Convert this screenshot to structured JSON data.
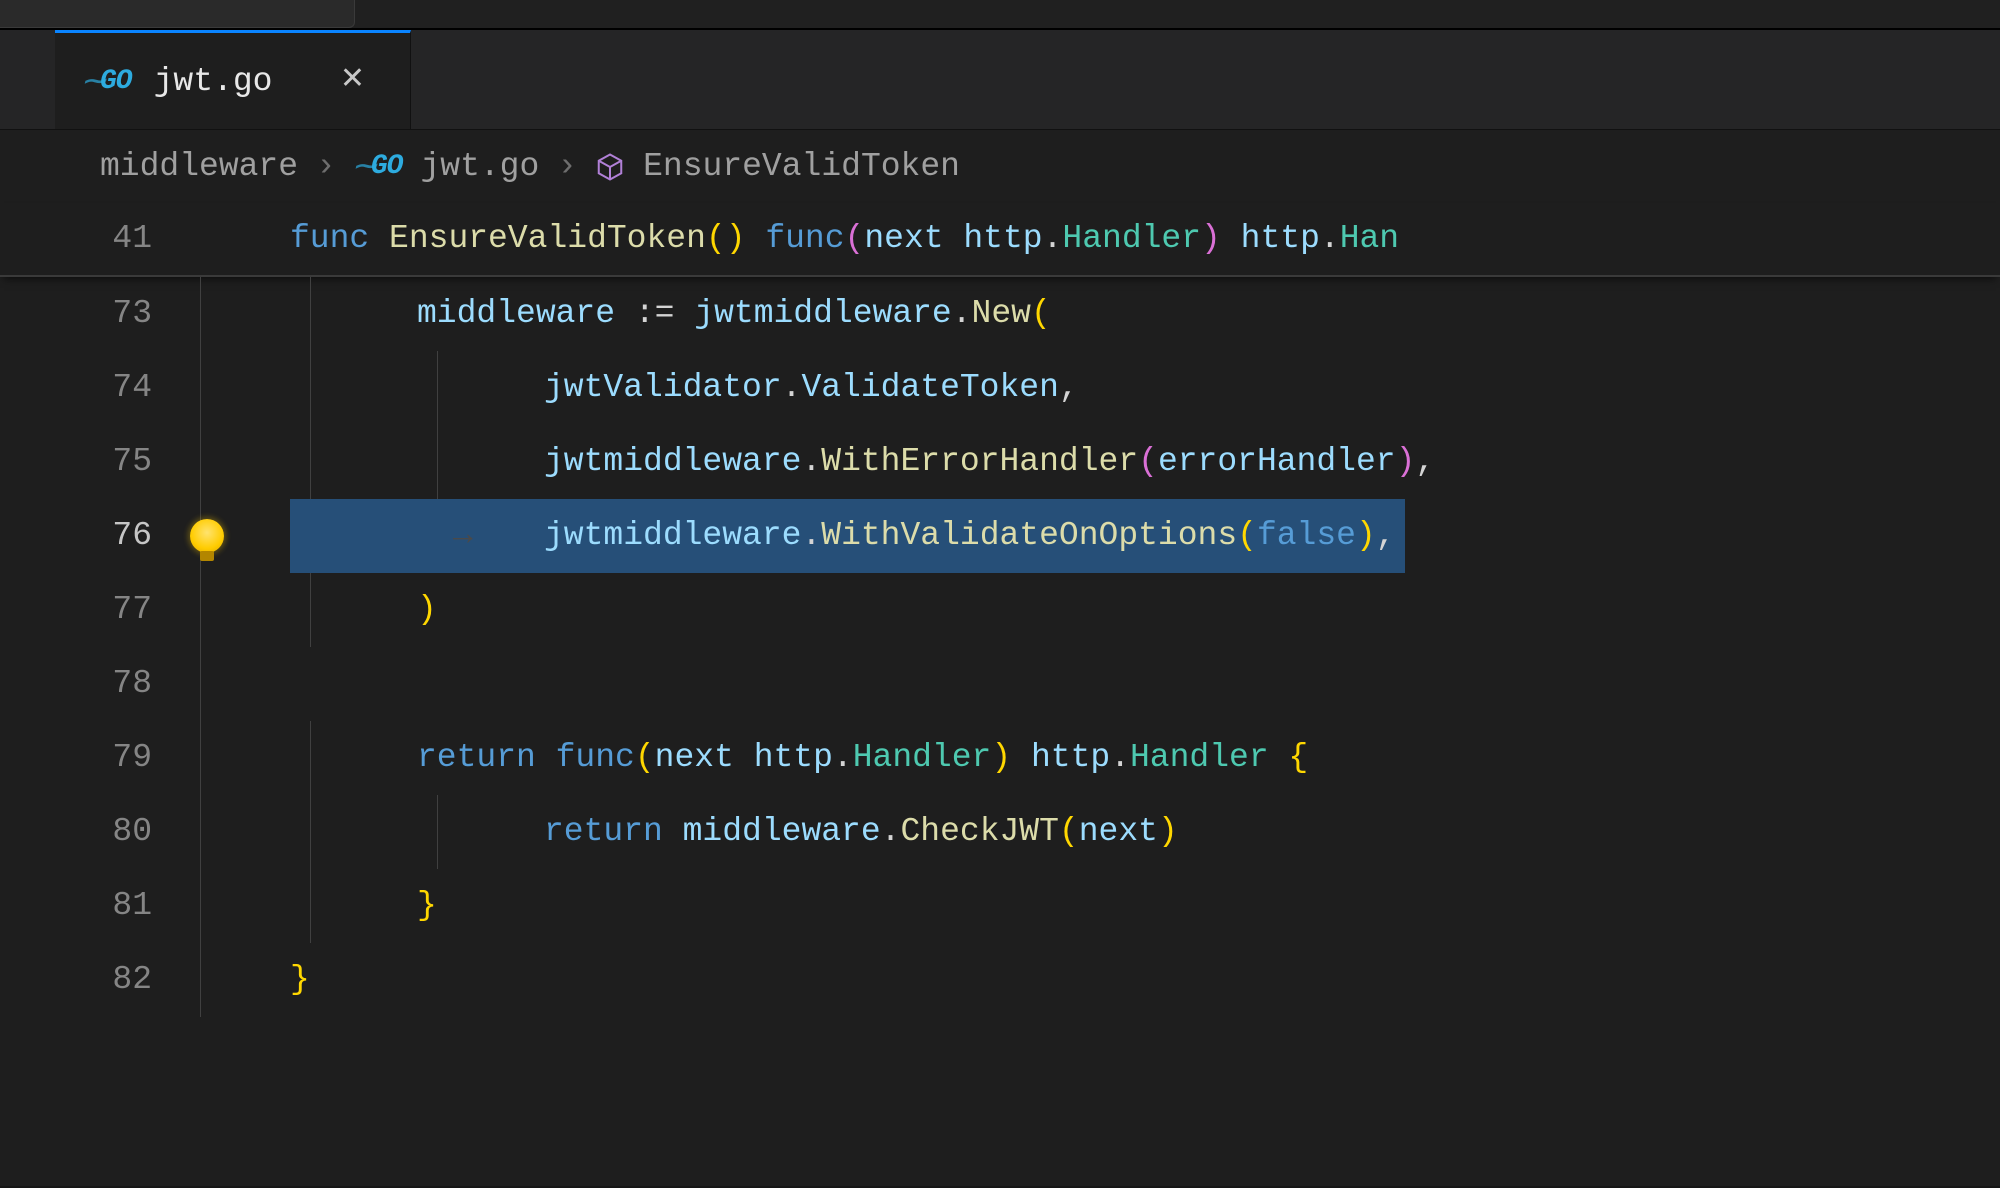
{
  "tab": {
    "filename": "jwt.go",
    "lang_badge": "GO"
  },
  "breadcrumb": {
    "folder": "middleware",
    "file": "jwt.go",
    "symbol": "EnsureValidToken"
  },
  "editor": {
    "sticky_line_num": "41",
    "current_line_num": "76",
    "lines": [
      {
        "n": "41",
        "sticky": true,
        "tokens": [
          {
            "t": "func ",
            "c": "kw"
          },
          {
            "t": "EnsureValidToken",
            "c": "fn"
          },
          {
            "t": "()",
            "c": "p1"
          },
          {
            "t": " ",
            "c": "pl"
          },
          {
            "t": "func",
            "c": "kw"
          },
          {
            "t": "(",
            "c": "p2"
          },
          {
            "t": "next ",
            "c": "vr"
          },
          {
            "t": "http",
            "c": "vr"
          },
          {
            "t": ".",
            "c": "op"
          },
          {
            "t": "Handler",
            "c": "ty"
          },
          {
            "t": ")",
            "c": "p2"
          },
          {
            "t": " ",
            "c": "pl"
          },
          {
            "t": "http",
            "c": "vr"
          },
          {
            "t": ".",
            "c": "op"
          },
          {
            "t": "Han",
            "c": "ty"
          }
        ]
      },
      {
        "n": "73",
        "indent": 1,
        "tokens": [
          {
            "t": "middleware",
            "c": "vr"
          },
          {
            "t": " ",
            "c": "pl"
          },
          {
            "t": ":=",
            "c": "op"
          },
          {
            "t": " ",
            "c": "pl"
          },
          {
            "t": "jwtmiddleware",
            "c": "vr"
          },
          {
            "t": ".",
            "c": "op"
          },
          {
            "t": "New",
            "c": "fn"
          },
          {
            "t": "(",
            "c": "p1"
          }
        ]
      },
      {
        "n": "74",
        "indent": 2,
        "tokens": [
          {
            "t": "jwtValidator",
            "c": "vr"
          },
          {
            "t": ".",
            "c": "op"
          },
          {
            "t": "ValidateToken",
            "c": "vr"
          },
          {
            "t": ",",
            "c": "op"
          }
        ]
      },
      {
        "n": "75",
        "indent": 2,
        "tokens": [
          {
            "t": "jwtmiddleware",
            "c": "vr"
          },
          {
            "t": ".",
            "c": "op"
          },
          {
            "t": "WithErrorHandler",
            "c": "fn"
          },
          {
            "t": "(",
            "c": "p2"
          },
          {
            "t": "errorHandler",
            "c": "vr"
          },
          {
            "t": ")",
            "c": "p2"
          },
          {
            "t": ",",
            "c": "op"
          }
        ]
      },
      {
        "n": "76",
        "indent": 2,
        "current": true,
        "bulb": true,
        "tokens": [
          {
            "t": "jwtmiddleware",
            "c": "vr"
          },
          {
            "t": ".",
            "c": "op"
          },
          {
            "t": "WithValidateOnOptions",
            "c": "fn"
          },
          {
            "t": "(",
            "c": "p1"
          },
          {
            "t": "false",
            "c": "cn"
          },
          {
            "t": ")",
            "c": "p1"
          },
          {
            "t": ",",
            "c": "op"
          }
        ]
      },
      {
        "n": "77",
        "indent": 1,
        "tokens": [
          {
            "t": ")",
            "c": "p1"
          }
        ]
      },
      {
        "n": "78",
        "indent": 0,
        "tokens": []
      },
      {
        "n": "79",
        "indent": 1,
        "tokens": [
          {
            "t": "return ",
            "c": "kw"
          },
          {
            "t": "func",
            "c": "kw"
          },
          {
            "t": "(",
            "c": "p1"
          },
          {
            "t": "next ",
            "c": "vr"
          },
          {
            "t": "http",
            "c": "vr"
          },
          {
            "t": ".",
            "c": "op"
          },
          {
            "t": "Handler",
            "c": "ty"
          },
          {
            "t": ")",
            "c": "p1"
          },
          {
            "t": " ",
            "c": "pl"
          },
          {
            "t": "http",
            "c": "vr"
          },
          {
            "t": ".",
            "c": "op"
          },
          {
            "t": "Handler",
            "c": "ty"
          },
          {
            "t": " {",
            "c": "p1"
          }
        ]
      },
      {
        "n": "80",
        "indent": 2,
        "tokens": [
          {
            "t": "return ",
            "c": "kw"
          },
          {
            "t": "middleware",
            "c": "vr"
          },
          {
            "t": ".",
            "c": "op"
          },
          {
            "t": "CheckJWT",
            "c": "fn"
          },
          {
            "t": "(",
            "c": "p1"
          },
          {
            "t": "next",
            "c": "vr"
          },
          {
            "t": ")",
            "c": "p1"
          }
        ]
      },
      {
        "n": "81",
        "indent": 1,
        "tokens": [
          {
            "t": "}",
            "c": "p1"
          }
        ]
      },
      {
        "n": "82",
        "indent": 0,
        "tokens": [
          {
            "t": "}",
            "c": "p1"
          }
        ]
      }
    ]
  }
}
